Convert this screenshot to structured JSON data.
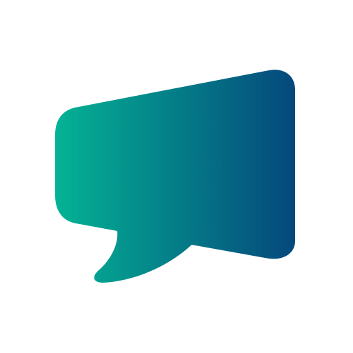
{
  "icon": {
    "name": "speech-bubble-icon",
    "gradient": {
      "start_color": "#04B394",
      "end_color": "#05487C"
    },
    "background_color": "#FFFFFF"
  }
}
